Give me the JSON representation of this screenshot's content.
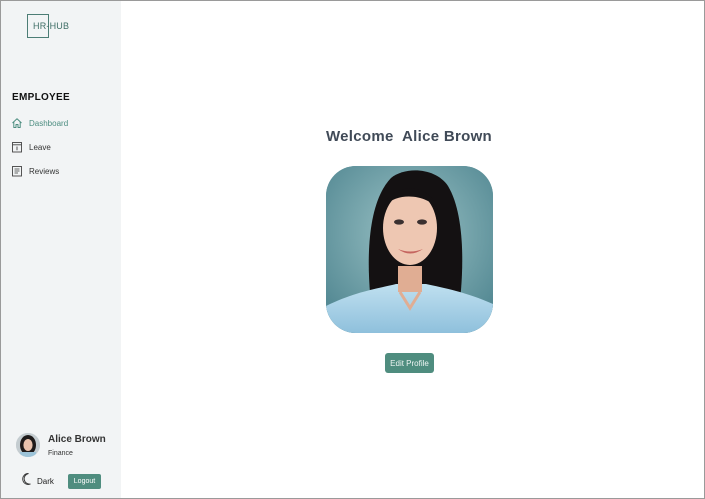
{
  "app": {
    "logo_text": "HR-HUB"
  },
  "sidebar": {
    "section_title": "EMPLOYEE",
    "items": [
      {
        "label": "Dashboard",
        "icon": "home-icon",
        "active": true
      },
      {
        "label": "Leave",
        "icon": "calendar-icon",
        "active": false
      },
      {
        "label": "Reviews",
        "icon": "clipboard-icon",
        "active": false
      }
    ]
  },
  "user": {
    "name": "Alice Brown",
    "department": "Finance"
  },
  "footer": {
    "theme_label": "Dark",
    "logout_label": "Logout"
  },
  "main": {
    "welcome_text": "Welcome  Alice Brown",
    "edit_profile_label": "Edit Profile"
  },
  "colors": {
    "accent": "#4f8d7f",
    "sidebar_bg": "#f2f4f5",
    "heading": "#404a57",
    "active_nav": "#4c8d80"
  }
}
